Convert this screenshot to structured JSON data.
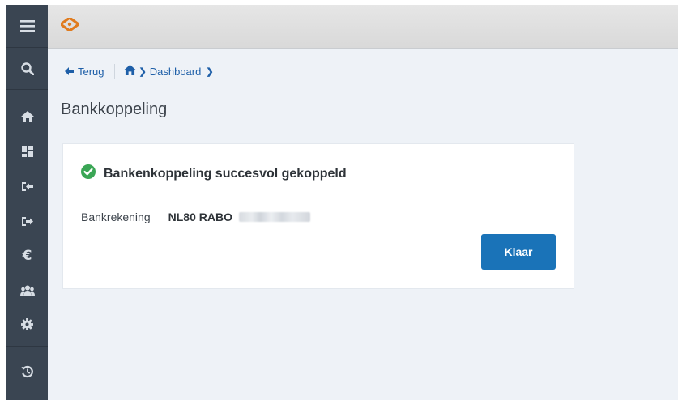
{
  "sidebar": {
    "items": [
      {
        "icon": "hamburger-menu-icon"
      },
      {
        "icon": "search-icon"
      },
      {
        "icon": "home-icon"
      },
      {
        "icon": "dashboard-icon"
      },
      {
        "icon": "sign-in-icon"
      },
      {
        "icon": "sign-out-icon"
      },
      {
        "icon": "euro-icon"
      },
      {
        "icon": "users-icon"
      },
      {
        "icon": "gear-icon"
      },
      {
        "icon": "history-icon"
      }
    ],
    "bg_color": "#3a4552"
  },
  "topbar": {
    "logo_icon": "brand-logo-icon",
    "logo_color": "#e07b1e"
  },
  "breadcrumb": {
    "back_label": "Terug",
    "home_icon": "home-icon",
    "dashboard_label": "Dashboard"
  },
  "page": {
    "title": "Bankkoppeling"
  },
  "card": {
    "success_icon": "check-circle-icon",
    "success_message": "Bankenkoppeling succesvol gekoppeld",
    "account_label": "Bankrekening",
    "account_value": "NL80 RABO",
    "account_number_masked": true,
    "done_button": "Klaar",
    "accent_color": "#1a73b8",
    "success_color": "#3aa655"
  }
}
